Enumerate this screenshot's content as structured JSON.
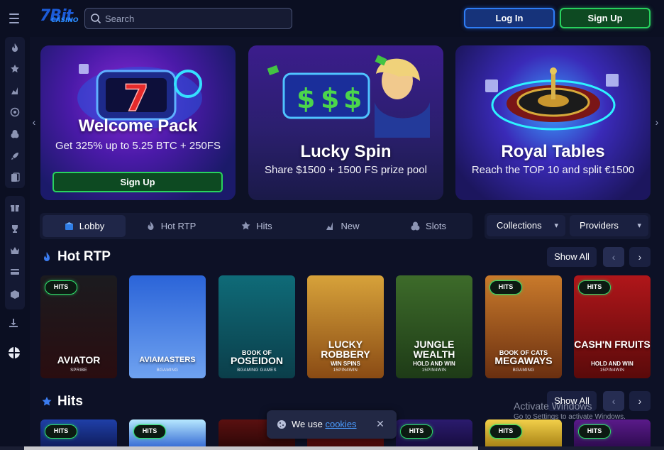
{
  "header": {
    "logo_text": "7Bit",
    "logo_sub": "CASINO",
    "search_placeholder": "Search",
    "login_label": "Log In",
    "signup_label": "Sign Up"
  },
  "sidebar": {
    "top_items": [
      "fire-icon",
      "star-icon",
      "new-icon",
      "target-icon",
      "coins-icon",
      "rocket-icon",
      "cards-icon"
    ],
    "middle_items": [
      "gift-icon",
      "trophy-icon",
      "crown-icon",
      "card-payment-icon",
      "box-icon"
    ],
    "bottom_items": [
      "download-icon",
      "language-icon"
    ]
  },
  "banners": [
    {
      "title": "Welcome Pack",
      "subtitle": "Get 325% up to 5.25 BTC + 250FS",
      "button": "Sign Up"
    },
    {
      "title": "Lucky Spin",
      "subtitle": "Share $1500 + 1500 FS prize pool"
    },
    {
      "title": "Royal Tables",
      "subtitle": "Reach the TOP 10 and split €1500"
    }
  ],
  "tabs": [
    {
      "label": "Lobby",
      "icon": "lobby-icon",
      "active": true
    },
    {
      "label": "Hot RTP",
      "icon": "fire-icon",
      "active": false
    },
    {
      "label": "Hits",
      "icon": "star-icon",
      "active": false
    },
    {
      "label": "New",
      "icon": "new-icon",
      "active": false
    },
    {
      "label": "Slots",
      "icon": "coins-icon",
      "active": false
    }
  ],
  "dropdowns": {
    "collections": "Collections",
    "providers": "Providers"
  },
  "hot_rtp": {
    "title": "Hot RTP",
    "show_all": "Show All",
    "games": [
      {
        "name": "AVIATOR",
        "provider": "SPRIBE",
        "badge": "HITS",
        "colors": [
          "#1b1b1f",
          "#2a0d10"
        ]
      },
      {
        "name": "AVIAMASTERS",
        "provider": "BGAMING",
        "badge": "",
        "colors": [
          "#2b64d8",
          "#6fa2f0"
        ]
      },
      {
        "name": "POSEIDON",
        "pre": "BOOK OF",
        "provider": "BGAMING GAMES",
        "badge": "",
        "colors": [
          "#0f6b78",
          "#0b3e4a"
        ]
      },
      {
        "name": "LUCKY ROBBERY",
        "sub": "WIN SPINS",
        "provider": "15PIN4WIN",
        "badge": "",
        "colors": [
          "#d7a23a",
          "#8a4b14"
        ]
      },
      {
        "name": "JUNGLE WEALTH",
        "sub": "HOLD AND WIN",
        "provider": "15PIN4WIN",
        "badge": "",
        "colors": [
          "#3d6b2a",
          "#1e3b17"
        ]
      },
      {
        "name": "MEGAWAYS",
        "pre": "BOOK OF CATS",
        "provider": "BGAMING",
        "badge": "HITS",
        "colors": [
          "#c97a2b",
          "#6a2f10"
        ]
      },
      {
        "name": "CASH'N FRUITS",
        "sub": "HOLD AND WIN",
        "provider": "15PIN4WIN",
        "badge": "HITS",
        "colors": [
          "#b0161a",
          "#5a0a0a"
        ]
      }
    ]
  },
  "hits": {
    "title": "Hits",
    "show_all": "Show All",
    "badges": [
      "HITS",
      "HITS",
      "",
      "",
      "HITS",
      "HITS",
      "HITS"
    ]
  },
  "cookie": {
    "text": "We use",
    "link": "cookies"
  },
  "watermark": {
    "line1": "Activate Windows",
    "line2": "Go to Settings to activate Windows."
  }
}
